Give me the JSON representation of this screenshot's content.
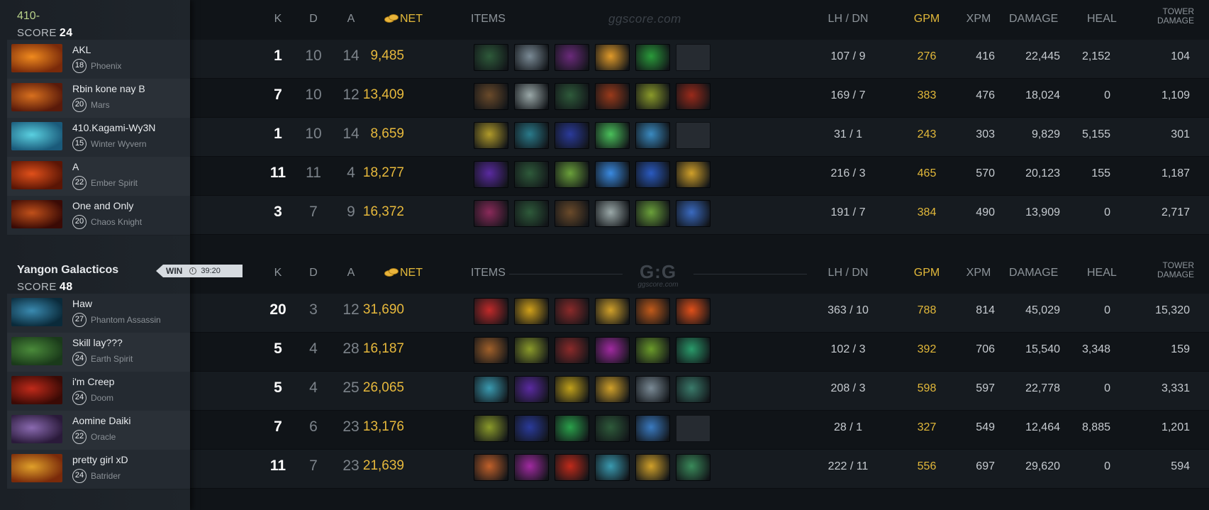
{
  "teams": [
    {
      "name": "410-",
      "score_label": "SCORE",
      "score": "24",
      "players": [
        {
          "name": "AKL",
          "level": "18",
          "hero": "Phoenix",
          "k": "1",
          "d": "10",
          "a": "14",
          "net": "9,485",
          "lhdn": "107  /  9",
          "gpm": "276",
          "xpm": "416",
          "damage": "22,445",
          "heal": "2,152",
          "tower": "104",
          "portrait_colors": [
            "#f08a1e",
            "#7a2a0a"
          ],
          "items": [
            "#2e5a3a",
            "#7a8a95",
            "#6a2a7a",
            "#e09a2a",
            "#2a9a3a",
            ""
          ]
        },
        {
          "name": "Rbin kone nay B",
          "level": "20",
          "hero": "Mars",
          "k": "7",
          "d": "10",
          "a": "12",
          "net": "13,409",
          "lhdn": "169  /  7",
          "gpm": "383",
          "xpm": "476",
          "damage": "18,024",
          "heal": "0",
          "tower": "1,109",
          "portrait_colors": [
            "#d8701e",
            "#5a1a0a"
          ],
          "items": [
            "#6a4a2a",
            "#9aa8a8",
            "#2e5a3a",
            "#9a3a1a",
            "#8a9a2a",
            "#9a2a1a"
          ]
        },
        {
          "name": "410.Kagami-Wy3N",
          "level": "15",
          "hero": "Winter Wyvern",
          "k": "1",
          "d": "10",
          "a": "14",
          "net": "8,659",
          "lhdn": "31  /  1",
          "gpm": "243",
          "xpm": "303",
          "damage": "9,829",
          "heal": "5,155",
          "tower": "301",
          "portrait_colors": [
            "#5ad0e0",
            "#1a5a7a"
          ],
          "items": [
            "#b09a2a",
            "#2a7a8a",
            "#2a3a9a",
            "#4ac05a",
            "#3a8ac0",
            ""
          ]
        },
        {
          "name": "A",
          "level": "22",
          "hero": "Ember Spirit",
          "k": "11",
          "d": "11",
          "a": "4",
          "net": "18,277",
          "lhdn": "216  /  3",
          "gpm": "465",
          "xpm": "570",
          "damage": "20,123",
          "heal": "155",
          "tower": "1,187",
          "portrait_colors": [
            "#e0501a",
            "#5a1505"
          ],
          "items": [
            "#5a2aa0",
            "#2e5a3a",
            "#6aa03a",
            "#3a8ae0",
            "#2a5ac0",
            "#d0a02a"
          ]
        },
        {
          "name": "One and Only",
          "level": "20",
          "hero": "Chaos Knight",
          "k": "3",
          "d": "7",
          "a": "9",
          "net": "16,372",
          "lhdn": "191  /  7",
          "gpm": "384",
          "xpm": "490",
          "damage": "13,909",
          "heal": "0",
          "tower": "2,717",
          "portrait_colors": [
            "#c0501a",
            "#3a0a05"
          ],
          "items": [
            "#8a2a5a",
            "#2e5a3a",
            "#6a4a2a",
            "#9aa8a8",
            "#6aa03a",
            "#3a6ac0"
          ]
        }
      ]
    },
    {
      "name": "Yangon Galacticos",
      "score_label": "SCORE",
      "score": "48",
      "players": [
        {
          "name": "Haw",
          "level": "27",
          "hero": "Phantom Assassin",
          "k": "20",
          "d": "3",
          "a": "12",
          "net": "31,690",
          "lhdn": "363  /  10",
          "gpm": "788",
          "xpm": "814",
          "damage": "45,029",
          "heal": "0",
          "tower": "15,320",
          "portrait_colors": [
            "#3a8ab0",
            "#0a2a3a"
          ],
          "items": [
            "#c02a2a",
            "#d0a01a",
            "#8a2a2a",
            "#d0a02a",
            "#c05a1a",
            "#e0501a"
          ]
        },
        {
          "name": "Skill lay???",
          "level": "24",
          "hero": "Earth Spirit",
          "k": "5",
          "d": "4",
          "a": "28",
          "net": "16,187",
          "lhdn": "102  /  3",
          "gpm": "392",
          "xpm": "706",
          "damage": "15,540",
          "heal": "3,348",
          "tower": "159",
          "portrait_colors": [
            "#4a8a3a",
            "#1a3a1a"
          ],
          "items": [
            "#a0602a",
            "#8a9a2a",
            "#8a2a2a",
            "#a02aa0",
            "#6a9a2a",
            "#2a9a6a"
          ]
        },
        {
          "name": "i'm Creep",
          "level": "24",
          "hero": "Doom",
          "k": "5",
          "d": "4",
          "a": "25",
          "net": "26,065",
          "lhdn": "208  /  3",
          "gpm": "598",
          "xpm": "597",
          "damage": "22,778",
          "heal": "0",
          "tower": "3,331",
          "portrait_colors": [
            "#c02a1a",
            "#3a0a05"
          ],
          "items": [
            "#3a9ab0",
            "#5a2aa0",
            "#c0a01a",
            "#d0a02a",
            "#7a8a95",
            "#3a7a6a"
          ]
        },
        {
          "name": "Aomine Daiki",
          "level": "22",
          "hero": "Oracle",
          "k": "7",
          "d": "6",
          "a": "23",
          "net": "13,176",
          "lhdn": "28  /  1",
          "gpm": "327",
          "xpm": "549",
          "damage": "12,464",
          "heal": "8,885",
          "tower": "1,201",
          "portrait_colors": [
            "#8a6ab0",
            "#2a1a3a"
          ],
          "items": [
            "#8a9a2a",
            "#2a3a9a",
            "#2aa04a",
            "#2e5a3a",
            "#3a7ac0",
            ""
          ]
        },
        {
          "name": "pretty girl xD",
          "level": "24",
          "hero": "Batrider",
          "k": "11",
          "d": "7",
          "a": "23",
          "net": "21,639",
          "lhdn": "222  /  11",
          "gpm": "556",
          "xpm": "697",
          "damage": "29,620",
          "heal": "0",
          "tower": "594",
          "portrait_colors": [
            "#e0a02a",
            "#7a2a0a"
          ],
          "items": [
            "#c0602a",
            "#a02aa0",
            "#c02a1a",
            "#3a9ab0",
            "#d0a02a",
            "#3a8a5a"
          ]
        }
      ]
    }
  ],
  "result": {
    "label": "WIN",
    "duration": "39:20",
    "icon": "clock-icon"
  },
  "columns": {
    "k": "K",
    "d": "D",
    "a": "A",
    "net": "NET",
    "items": "ITEMS",
    "lhdn": "LH  /  DN",
    "gpm": "GPM",
    "xpm": "XPM",
    "damage": "DAMAGE",
    "heal": "HEAL",
    "tower_line1": "TOWER",
    "tower_line2": "DAMAGE",
    "net_icon": "coins-icon"
  },
  "watermark": "ggscore.com",
  "logo": {
    "main": "G:G",
    "sub": "ggscore.com"
  },
  "colors": {
    "gold": "#e3b93a",
    "background": "#14181d",
    "panel": "#262c33"
  }
}
